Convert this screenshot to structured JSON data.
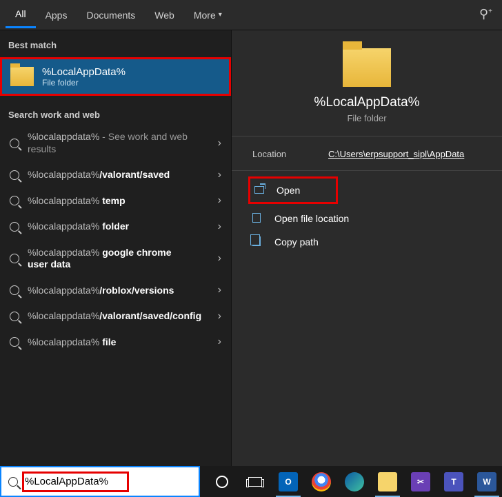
{
  "tabs": {
    "all": "All",
    "apps": "Apps",
    "documents": "Documents",
    "web": "Web",
    "more": "More"
  },
  "sections": {
    "best_match": "Best match",
    "search_work_web": "Search work and web"
  },
  "best": {
    "title": "%LocalAppData%",
    "subtitle": "File folder"
  },
  "suggestions": [
    {
      "pre": "%localappdata%",
      "bold": "",
      "hint": " - See work and web results"
    },
    {
      "pre": "%localappdata%",
      "bold": "/valorant/saved",
      "hint": ""
    },
    {
      "pre": "%localappdata% ",
      "bold": "temp",
      "hint": ""
    },
    {
      "pre": "%localappdata% ",
      "bold": "folder",
      "hint": ""
    },
    {
      "pre": "%localappdata% ",
      "bold": "google chrome user data",
      "hint": ""
    },
    {
      "pre": "%localappdata%",
      "bold": "/roblox/versions",
      "hint": ""
    },
    {
      "pre": "%localappdata%",
      "bold": "/valorant/saved/config",
      "hint": ""
    },
    {
      "pre": "%localappdata% ",
      "bold": "file",
      "hint": ""
    }
  ],
  "preview": {
    "title": "%LocalAppData%",
    "subtitle": "File folder",
    "location_label": "Location",
    "location_value": "C:\\Users\\erpsupport_sipl\\AppData"
  },
  "actions": {
    "open": "Open",
    "open_location": "Open file location",
    "copy_path": "Copy path"
  },
  "search_input": "%LocalAppData%",
  "taskbar_apps": [
    "outlook",
    "chrome",
    "edge",
    "explorer",
    "snip",
    "teams",
    "word"
  ]
}
